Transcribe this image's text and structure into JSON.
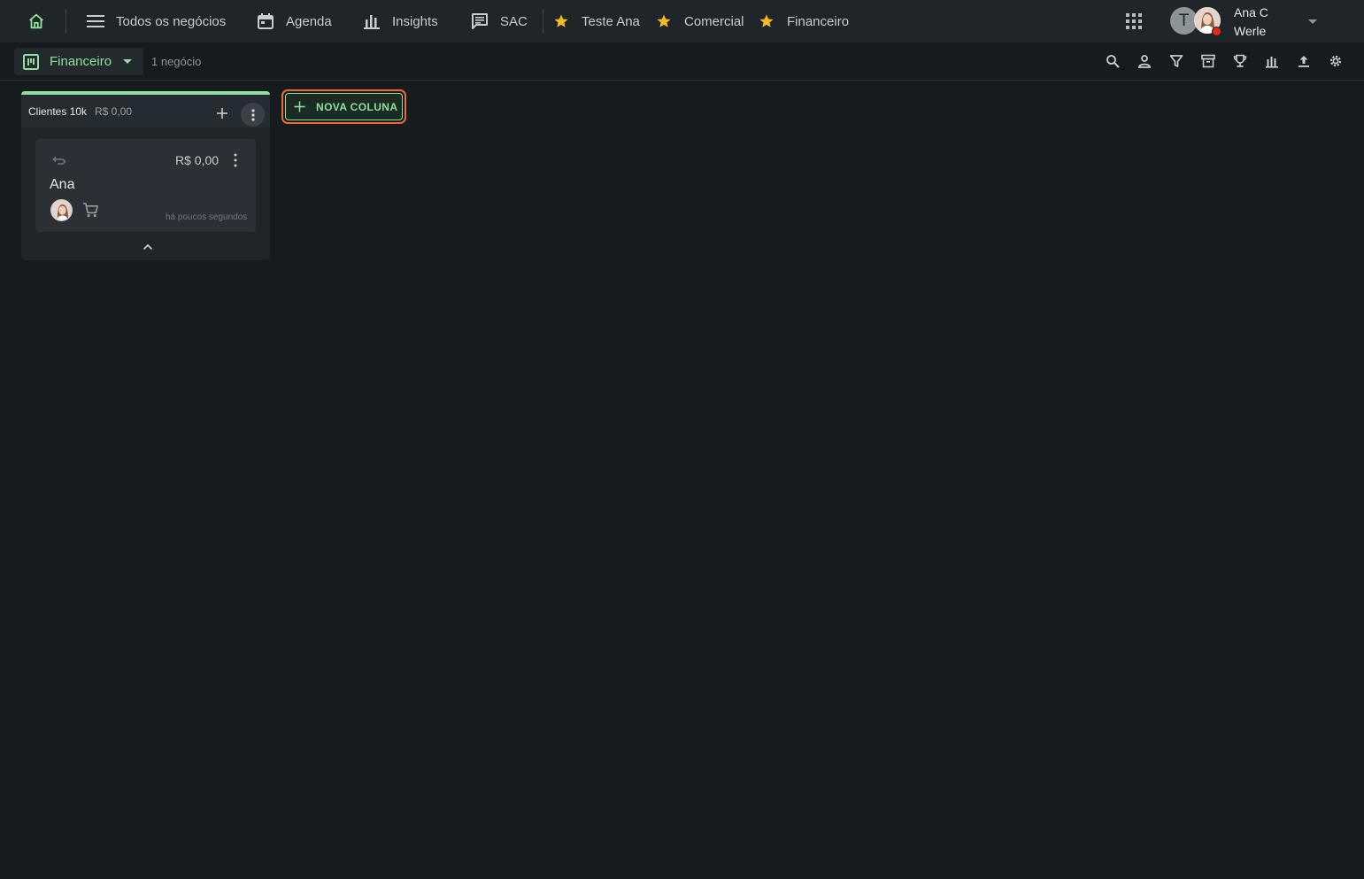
{
  "nav": {
    "items": [
      {
        "label": "Todos os negócios",
        "icon": "menu-icon"
      },
      {
        "label": "Agenda",
        "icon": "calendar-icon"
      },
      {
        "label": "Insights",
        "icon": "bar-chart-icon"
      },
      {
        "label": "SAC",
        "icon": "chat-icon"
      }
    ],
    "favorites": [
      {
        "label": "Teste Ana",
        "icon": "star-icon"
      },
      {
        "label": "Comercial",
        "icon": "star-icon"
      },
      {
        "label": "Financeiro",
        "icon": "star-icon"
      }
    ]
  },
  "user": {
    "initial": "T",
    "name_line1": "Ana C",
    "name_line2": "Werle",
    "status_color": "#e5281f"
  },
  "subheader": {
    "pipeline_name": "Financeiro",
    "deal_count": "1 negócio"
  },
  "board": {
    "columns": [
      {
        "title": "Clientes 10k",
        "total": "R$ 0,00",
        "accent_color": "#8ee09a",
        "cards": [
          {
            "value": "R$ 0,00",
            "title": "Ana",
            "time": "há poucos segundos"
          }
        ]
      }
    ],
    "new_column_label": "NOVA COLUNA"
  },
  "colors": {
    "accent": "#8ee09a",
    "focus": "#f0682e",
    "star": "#f5b922",
    "background": "#151b1f",
    "panel": "#1f2529"
  }
}
